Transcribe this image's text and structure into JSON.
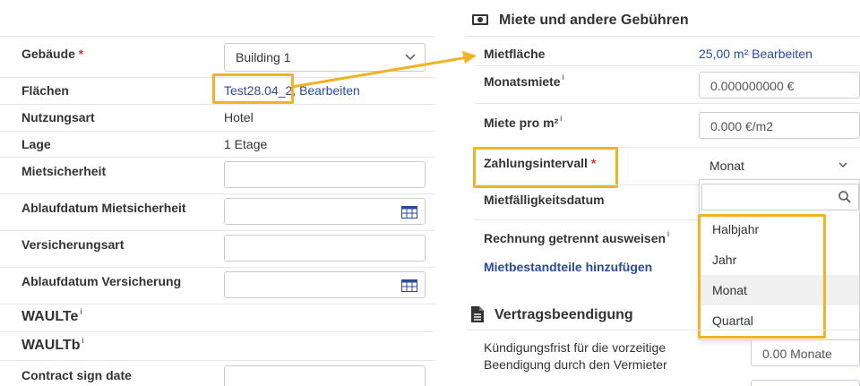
{
  "left": {
    "building_label": "Gebäude",
    "required_mark": "*",
    "building_value": "Building 1",
    "areas_label": "Flächen",
    "areas_value": "Test28.04_2,",
    "areas_edit": "Bearbeiten",
    "usage_label": "Nutzungsart",
    "usage_value": "Hotel",
    "location_label": "Lage",
    "location_value": "1 Etage",
    "deposit_label": "Mietsicherheit",
    "deposit_expiry_label": "Ablaufdatum Mietsicherheit",
    "insurance_type_label": "Versicherungsart",
    "insurance_expiry_label": "Ablaufdatum Versicherung",
    "waulte_label": "WAULTe",
    "waultb_label": "WAULTb",
    "info_mark": "i",
    "contract_sign_label": "Contract sign date"
  },
  "right": {
    "section_rent_title": "Miete und andere Gebühren",
    "rent_area_label": "Mietfläche",
    "rent_area_value": "25,00 m²",
    "rent_area_edit": "Bearbeiten",
    "monthly_rent_label": "Monatsmiete",
    "monthly_rent_value": "0.000000000 €",
    "rent_per_m2_label": "Miete pro m²",
    "rent_per_m2_value": "0.000 €/m2",
    "payment_interval_label": "Zahlungsintervall",
    "payment_interval_value": "Monat",
    "due_date_label": "Mietfälligkeitsdatum",
    "separate_invoice_label": "Rechnung getrennt ausweisen",
    "add_components_link": "Mietbestandteile hinzufügen",
    "dropdown_options": [
      "Halbjahr",
      "Jahr",
      "Monat",
      "Quartal"
    ],
    "section_termination_title": "Vertragsbeendigung",
    "notice_period_label_1": "Kündigungsfrist für die vorzeitige",
    "notice_period_label_2": "Beendigung durch den Vermieter",
    "notice_period_value": "0.00 Monate"
  },
  "colors": {
    "highlight": "#f0b323",
    "link": "#2a4b9b",
    "required": "#d9342b",
    "selected_option_bg": "#f0f0f0"
  }
}
